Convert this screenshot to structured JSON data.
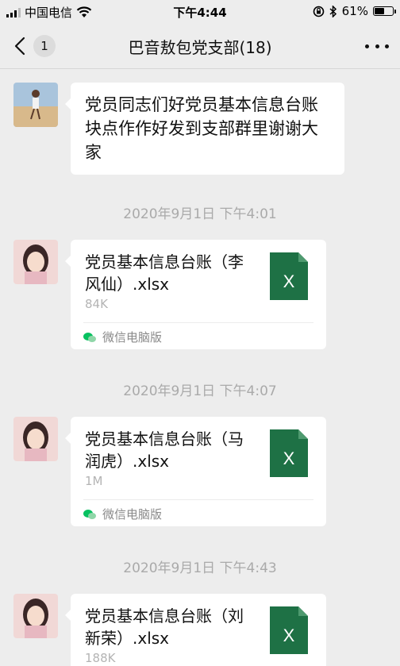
{
  "status_bar": {
    "carrier": "中国电信",
    "time": "下午4:44",
    "battery": "61%",
    "battery_level": 0.61,
    "icons": [
      "signal-icon",
      "wifi-icon",
      "orientation-lock-icon",
      "bluetooth-icon",
      "battery-icon"
    ]
  },
  "nav": {
    "back_icon": "chevron-left-icon",
    "unread_count": "1",
    "title": "巴音敖包党支部(18)",
    "more_icon": "more-icon"
  },
  "messages": [
    {
      "type": "text",
      "text": "党员同志们好党员基本信息台账块点作作好发到支部群里谢谢大家"
    },
    {
      "type": "time",
      "text": "2020年9月1日 下午4:01"
    },
    {
      "type": "file",
      "name": "党员基本信息台账（李风仙）.xlsx",
      "size": "84K",
      "source": "微信电脑版",
      "file_icon": "excel-file-icon",
      "icon_letter": "X"
    },
    {
      "type": "time",
      "text": "2020年9月1日 下午4:07"
    },
    {
      "type": "file",
      "name": "党员基本信息台账（马润虎）.xlsx",
      "size": "1M",
      "source": "微信电脑版",
      "file_icon": "excel-file-icon",
      "icon_letter": "X"
    },
    {
      "type": "time",
      "text": "2020年9月1日 下午4:43"
    },
    {
      "type": "file",
      "name": "党员基本信息台账（刘新荣）.xlsx",
      "size": "188K",
      "source": "",
      "file_icon": "excel-file-icon",
      "icon_letter": "X"
    }
  ],
  "colors": {
    "background": "#ededed",
    "bubble": "#ffffff",
    "excel_green": "#1e7145",
    "wechat_green": "#07c160"
  }
}
